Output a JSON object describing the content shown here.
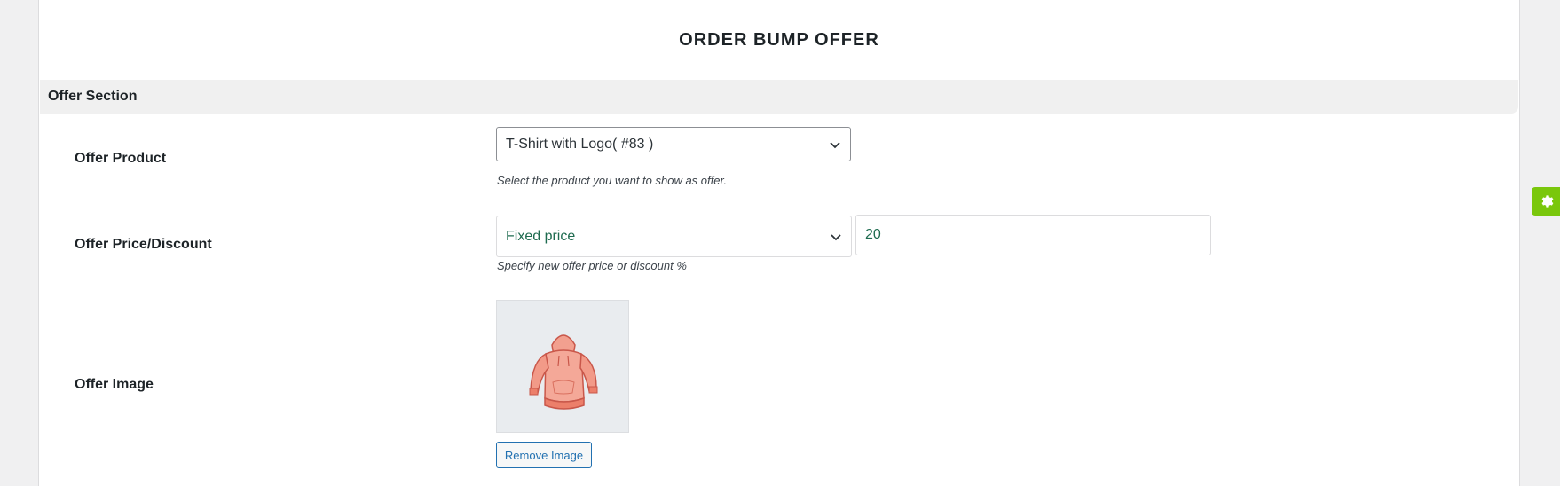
{
  "page": {
    "title": "ORDER BUMP OFFER"
  },
  "section": {
    "title": "Offer Section"
  },
  "offer_product": {
    "label": "Offer Product",
    "selected": "T-Shirt with Logo( #83 )",
    "hint": "Select the product you want to show as offer."
  },
  "offer_price": {
    "label": "Offer Price/Discount",
    "type_selected": "Fixed price",
    "value": "20",
    "hint": "Specify new offer price or discount %"
  },
  "offer_image": {
    "label": "Offer Image",
    "remove_label": "Remove Image",
    "image_icon": "hoodie-image"
  },
  "settings": {
    "icon": "gear-icon",
    "color": "#7ac70c"
  }
}
